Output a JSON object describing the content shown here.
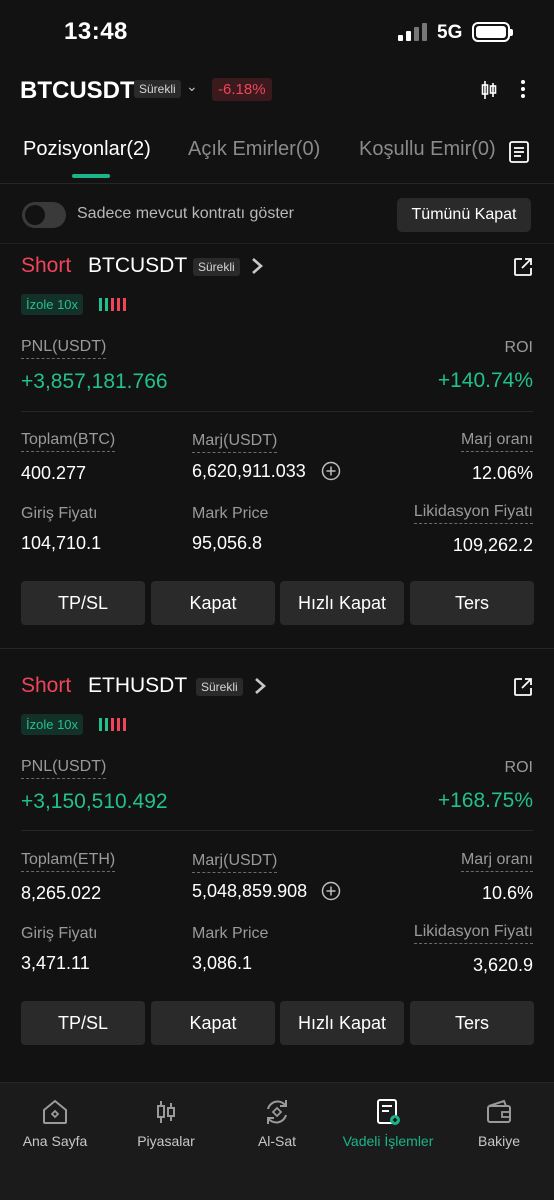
{
  "status_bar": {
    "time": "13:48",
    "network": "5G"
  },
  "header": {
    "symbol": "BTCUSDT",
    "contract_type": "Sürekli",
    "change": "-6.18%"
  },
  "tabs": [
    {
      "label": "Pozisyonlar(2)",
      "active": true
    },
    {
      "label": "Açık Emirler(0)",
      "active": false
    },
    {
      "label": "Koşullu Emir(0)",
      "active": false
    }
  ],
  "filter": {
    "label": "Sadece mevcut kontratı göster",
    "close_all": "Tümünü Kapat"
  },
  "labels": {
    "pnl": "PNL(USDT)",
    "roi": "ROI",
    "margin": "Marj(USDT)",
    "margin_ratio": "Marj oranı",
    "entry_price": "Giriş Fiyatı",
    "mark_price": "Mark Price",
    "liq_price": "Likidasyon Fiyatı"
  },
  "positions": [
    {
      "side": "Short",
      "pair": "BTCUSDT",
      "contract_type": "Sürekli",
      "margin_mode": "İzole 10x",
      "pnl": "+3,857,181.766",
      "roi": "+140.74%",
      "total_label": "Toplam(BTC)",
      "total": "400.277",
      "margin": "6,620,911.033",
      "margin_ratio": "12.06%",
      "entry_price": "104,710.1",
      "mark_price": "95,056.8",
      "liq_price": "109,262.2"
    },
    {
      "side": "Short",
      "pair": "ETHUSDT",
      "contract_type": "Sürekli",
      "margin_mode": "İzole 10x",
      "pnl": "+3,150,510.492",
      "roi": "+168.75%",
      "total_label": "Toplam(ETH)",
      "total": "8,265.022",
      "margin": "5,048,859.908",
      "margin_ratio": "10.6%",
      "entry_price": "3,471.11",
      "mark_price": "3,086.1",
      "liq_price": "3,620.9"
    }
  ],
  "actions": {
    "tpsl": "TP/SL",
    "close": "Kapat",
    "quick_close": "Hızlı Kapat",
    "reverse": "Ters"
  },
  "bottom_nav": [
    {
      "label": "Ana Sayfa",
      "icon": "home-icon",
      "active": false
    },
    {
      "label": "Piyasalar",
      "icon": "candlestick-icon",
      "active": false
    },
    {
      "label": "Al-Sat",
      "icon": "exchange-icon",
      "active": false
    },
    {
      "label": "Vadeli İşlemler",
      "icon": "futures-icon",
      "active": true
    },
    {
      "label": "Bakiye",
      "icon": "wallet-icon",
      "active": false
    }
  ],
  "colors": {
    "accent": "#1bb58a",
    "profit": "#22c08b",
    "loss": "#f0445b",
    "background": "#121212"
  }
}
